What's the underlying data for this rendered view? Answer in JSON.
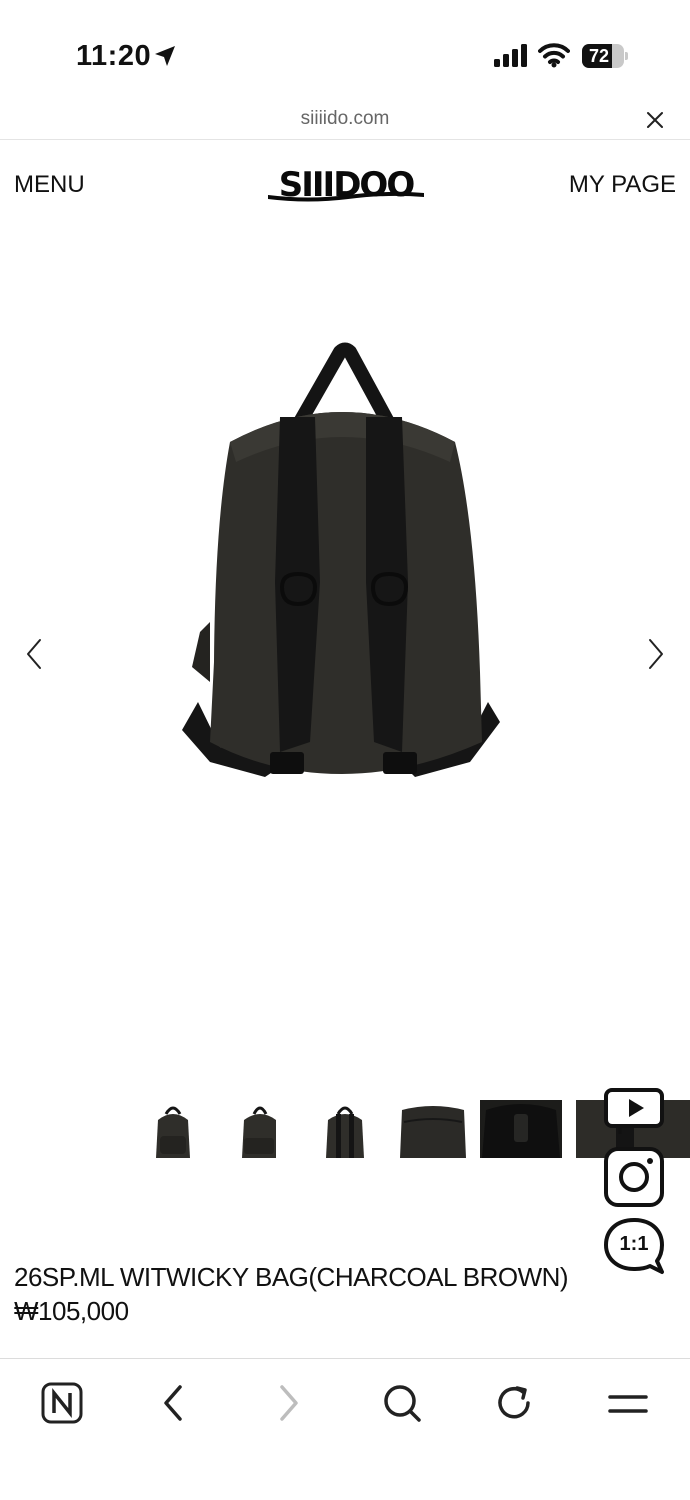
{
  "status_bar": {
    "time": "11:20",
    "battery_percent": "72",
    "battery_level": 0.72,
    "icons": [
      "location-arrow-icon",
      "cellular-signal-icon",
      "wifi-icon",
      "battery-icon"
    ]
  },
  "browser": {
    "url": "siiiido.com",
    "close_icon": "close-icon"
  },
  "header": {
    "menu_label": "MENU",
    "logo_text": "SIIIDOO",
    "mypage_label": "MY PAGE"
  },
  "gallery": {
    "prev_icon": "chevron-left-icon",
    "next_icon": "chevron-right-icon",
    "main_image": "backpack-back-view",
    "thumbnails": [
      "backpack-front",
      "backpack-side",
      "backpack-back",
      "bag-detail-pocket",
      "bag-interior",
      "bag-strap-detail"
    ]
  },
  "social": {
    "video_icon": "video-play-icon",
    "instagram_icon": "instagram-icon",
    "chat_label": "1:1"
  },
  "product": {
    "name": "26SP.ML WITWICKY BAG(CHARCOAL BROWN)",
    "price": "₩105,000"
  },
  "toolbar": {
    "icons": [
      "naver-home-icon",
      "back-icon",
      "forward-icon",
      "search-icon",
      "reload-icon",
      "menu-icon"
    ]
  },
  "colors": {
    "text": "#111111",
    "bag": "#2f2e2a",
    "strap": "#141414",
    "disabled": "#bdbdbd"
  }
}
